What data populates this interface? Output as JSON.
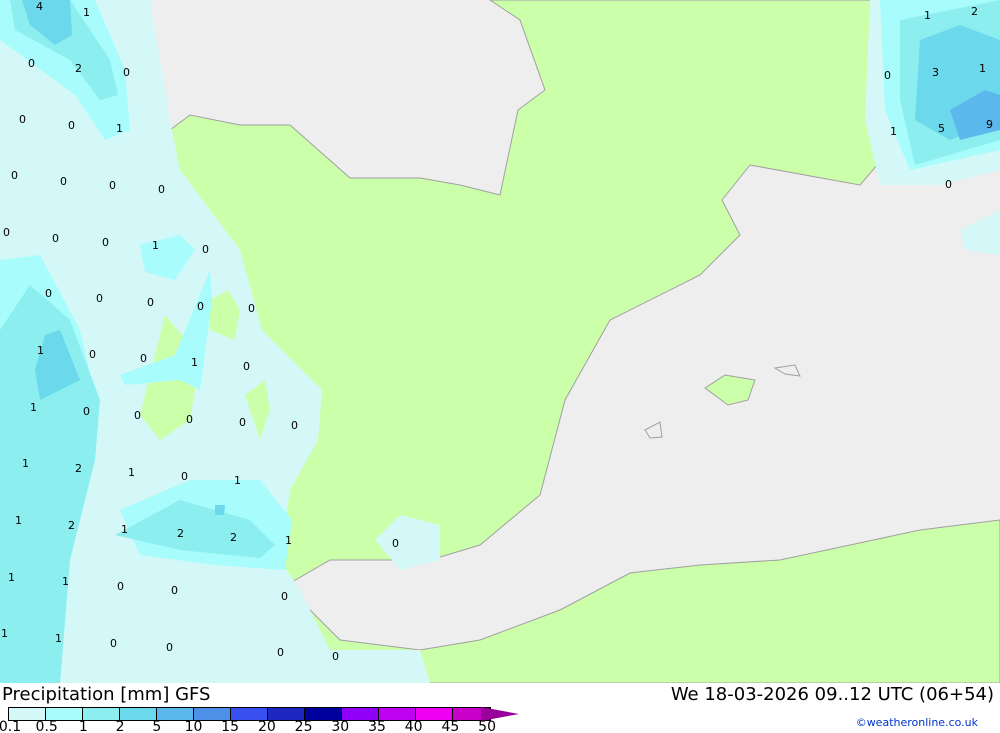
{
  "title": "Precipitation [mm] GFS",
  "datetime": "We 18-03-2026 09..12 UTC (06+54)",
  "credit": "©weatheronline.co.uk",
  "legend": {
    "ticks": [
      "0.1",
      "0.5",
      "1",
      "2",
      "5",
      "10",
      "15",
      "20",
      "25",
      "30",
      "35",
      "40",
      "45",
      "50"
    ],
    "colors": [
      "#d4f8f8",
      "#a8fcfc",
      "#8ceeee",
      "#6cd8ec",
      "#5cb8ec",
      "#4c90e8",
      "#3850f0",
      "#1c28c0",
      "#00009c",
      "#9000f8",
      "#c000f0",
      "#f000f0",
      "#c800c8"
    ]
  },
  "map_colors": {
    "sea": "#eeeeee",
    "land": "#ccffaa",
    "coast": "#a0a0a0"
  },
  "point_values": [
    "4",
    "1",
    "0",
    "2",
    "0",
    "0",
    "0",
    "1",
    "0",
    "0",
    "0",
    "0",
    "0",
    "0",
    "0",
    "1",
    "0",
    "0",
    "0",
    "0",
    "0",
    "0",
    "1",
    "0",
    "0",
    "1",
    "0",
    "1",
    "0",
    "0",
    "0",
    "0",
    "0",
    "1",
    "2",
    "1",
    "0",
    "1",
    "1",
    "2",
    "1",
    "2",
    "2",
    "1",
    "0",
    "1",
    "1",
    "0",
    "0",
    "0",
    "1",
    "1",
    "0",
    "0",
    "0",
    "0",
    "1",
    "2",
    "0",
    "3",
    "1",
    "1",
    "5",
    "9",
    "0"
  ]
}
